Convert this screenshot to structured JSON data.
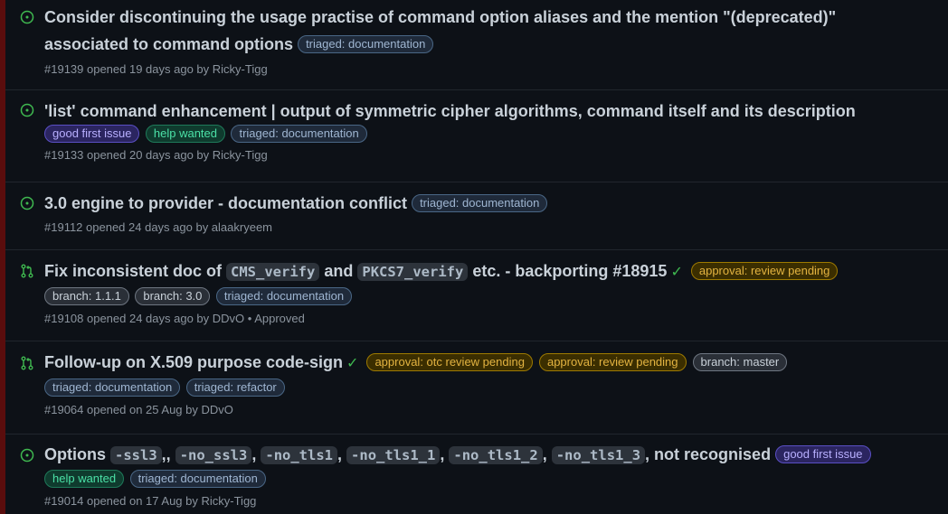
{
  "issues": [
    {
      "type": "issue",
      "title": "Consider discontinuing the usage practise of command option aliases and the mention \"(deprecated)\" associated to command options",
      "labels": [
        "triaged: documentation"
      ],
      "meta": "#19139 opened 19 days ago by Ricky-Tigg"
    },
    {
      "type": "issue",
      "title": "'list' command enhancement | output of symmetric cipher algorithms, command itself and its description",
      "labels": [
        "good first issue",
        "help wanted",
        "triaged: documentation"
      ],
      "meta": "#19133 opened 20 days ago by Ricky-Tigg"
    },
    {
      "type": "issue",
      "title": "3.0 engine to provider - documentation conflict",
      "labels": [
        "triaged: documentation"
      ],
      "meta": "#19112 opened 24 days ago by alaakryeem"
    },
    {
      "type": "pr",
      "title_parts": [
        "Fix inconsistent doc of ",
        "CMS_verify",
        " and ",
        "PKCS7_verify",
        " etc. - backporting #18915"
      ],
      "labels": [
        "approval: review pending",
        "branch: 1.1.1",
        "branch: 3.0",
        "triaged: documentation"
      ],
      "meta": "#19108 opened 24 days ago by DDvO • Approved"
    },
    {
      "type": "pr",
      "title": "Follow-up on X.509 purpose code-sign",
      "labels": [
        "approval: otc review pending",
        "approval: review pending",
        "branch: master",
        "triaged: documentation",
        "triaged: refactor"
      ],
      "meta": "#19064 opened on 25 Aug by DDvO"
    },
    {
      "type": "issue",
      "title_parts": [
        "Options ",
        "-ssl3",
        ",, ",
        "-no_ssl3",
        ", ",
        "-no_tls1",
        ", ",
        "-no_tls1_1",
        ", ",
        "-no_tls1_2",
        ", ",
        "-no_tls1_3",
        ", not recognised"
      ],
      "labels": [
        "good first issue",
        "help wanted",
        "triaged: documentation"
      ],
      "meta": "#19014 opened on 17 Aug by Ricky-Tigg"
    }
  ],
  "colors": {
    "open_issue": "#3fb950",
    "check": "#3fb950"
  },
  "icons": {
    "issue": "issue-opened-icon",
    "pr": "pull-request-icon",
    "check": "check-icon"
  }
}
